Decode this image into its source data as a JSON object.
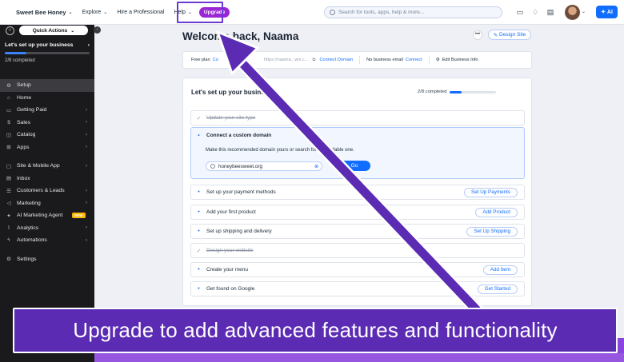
{
  "topbar": {
    "site_name": "Sweet Bee Honey",
    "explore": "Explore",
    "hire": "Hire a Professional",
    "help": "Help",
    "upgrade": "Upgrade",
    "search_placeholder": "Search for tools, apps, help & more...",
    "ai": "AI"
  },
  "sidebar": {
    "quick_actions": "Quick Actions",
    "setup_title": "Let's set up your business",
    "setup_progress_text": "2/8 completed",
    "setup_progress": 0.25,
    "items": [
      {
        "label": "Setup",
        "icon": "setup-icon",
        "glyph": "⚙",
        "active": true,
        "chevron": false
      },
      {
        "label": "Home",
        "icon": "home-icon",
        "glyph": "⌂",
        "chevron": false
      },
      {
        "label": "Getting Paid",
        "icon": "wallet-icon",
        "glyph": "▭",
        "chevron": true
      },
      {
        "label": "Sales",
        "icon": "dollar-icon",
        "glyph": "$",
        "chevron": true
      },
      {
        "label": "Catalog",
        "icon": "catalog-icon",
        "glyph": "◫",
        "chevron": true
      },
      {
        "label": "Apps",
        "icon": "apps-icon",
        "glyph": "⊞",
        "chevron": true
      },
      {
        "label": "Site & Mobile App",
        "icon": "site-icon",
        "glyph": "▢",
        "chevron": true,
        "gap_before": true
      },
      {
        "label": "Inbox",
        "icon": "inbox-icon",
        "glyph": "▤",
        "chevron": false
      },
      {
        "label": "Customers & Leads",
        "icon": "customers-icon",
        "glyph": "☰",
        "chevron": true
      },
      {
        "label": "Marketing",
        "icon": "marketing-icon",
        "glyph": "◁",
        "chevron": true
      },
      {
        "label": "AI Marketing Agent",
        "icon": "ai-agent-icon",
        "glyph": "✦",
        "chevron": false,
        "badge": "NEW"
      },
      {
        "label": "Analytics",
        "icon": "analytics-icon",
        "glyph": "⌇",
        "chevron": true
      },
      {
        "label": "Automations",
        "icon": "automations-icon",
        "glyph": "ϟ",
        "chevron": true
      },
      {
        "label": "Settings",
        "icon": "settings-icon",
        "glyph": "⚙",
        "chevron": false,
        "gap_before": true
      }
    ]
  },
  "main": {
    "welcome": "Welcome back, Naama",
    "design_site": "Design Site",
    "info_bar": {
      "plan": "Free plan",
      "plan_link": "Co",
      "url": "https://naama...wix.c...",
      "connect_domain": "Connect Domain",
      "email_text": "No business email",
      "email_link": "Connect",
      "edit_info": "Edit Business Info"
    },
    "setup_panel": {
      "title": "Let's set up your business",
      "count": "2/8 completed",
      "progress": 0.25,
      "expanded": {
        "title": "Connect a custom domain",
        "description": "Make this recommended domain yours or search for an available one.",
        "domain_value": "honeybeesweet.org",
        "go": "Go"
      },
      "tasks": [
        {
          "label": "Update your site type",
          "done": true,
          "button": ""
        },
        {
          "label": "Set up your payment methods",
          "done": false,
          "button": "Set Up Payments"
        },
        {
          "label": "Add your first product",
          "done": false,
          "button": "Add Product"
        },
        {
          "label": "Set up shipping and delivery",
          "done": false,
          "button": "Set Up Shipping"
        },
        {
          "label": "Design your website",
          "done": true,
          "button": ""
        },
        {
          "label": "Create your menu",
          "done": false,
          "button": "Add Item"
        },
        {
          "label": "Get found on Google",
          "done": false,
          "button": "Get Started"
        }
      ]
    }
  },
  "banner": {
    "text": "Upgrade to add advanced features and functionality"
  },
  "colors": {
    "accent": "#116dff",
    "upgrade": "#9a27d5",
    "annotation": "#5b2bb4"
  }
}
